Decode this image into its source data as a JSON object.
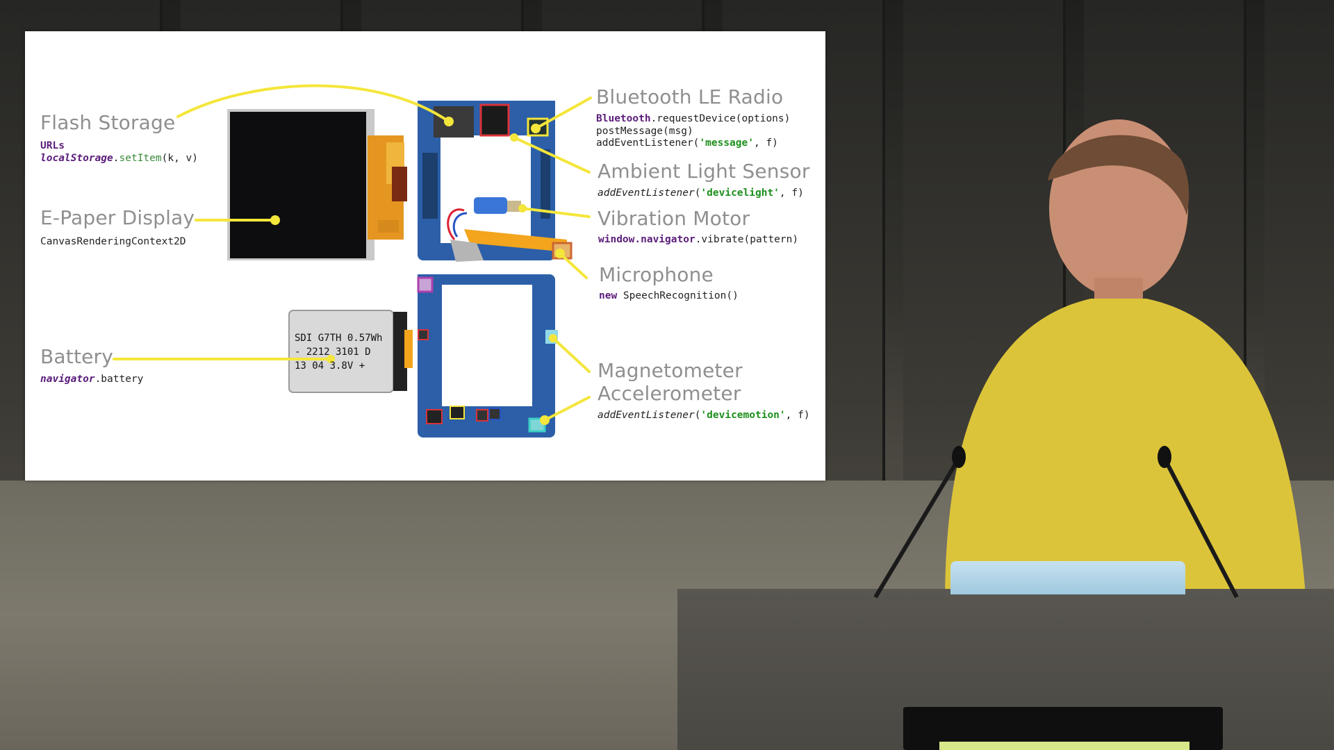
{
  "slide": {
    "flash": {
      "title": "Flash Storage",
      "code_line1": "URLs",
      "code_kw": "localStorage",
      "code_dot": ".",
      "code_fn": "setItem",
      "code_args": "(k, v)"
    },
    "epaper": {
      "title": "E-Paper Display",
      "code": "CanvasRenderingContext2D"
    },
    "battery": {
      "title": "Battery",
      "code_kw": "navigator",
      "code_rest": ".battery",
      "label_text": "SDI G7TH 0.57Wh - 2212 3101 D 13 04 3.8V +"
    },
    "bluetooth": {
      "title": "Bluetooth LE Radio",
      "code_kw": "Bluetooth",
      "code_rest1": ".requestDevice(options)",
      "code_line2": "postMessage(msg)",
      "code_line3_a": "addEventListener(",
      "code_line3_str": "'message'",
      "code_line3_b": ", f)"
    },
    "light": {
      "title": "Ambient Light Sensor",
      "code_a": "addEventListener",
      "code_b": "(",
      "code_str": "'devicelight'",
      "code_c": ", f)"
    },
    "vibration": {
      "title": "Vibration Motor",
      "code_kw": "window.navigator",
      "code_rest": ".vibrate(pattern)"
    },
    "microphone": {
      "title": "Microphone",
      "code_kw": "new",
      "code_rest": " SpeechRecognition()"
    },
    "magnetometer": {
      "title": "Magnetometer"
    },
    "accelerometer": {
      "title": "Accelerometer",
      "code_a": "addEventListener",
      "code_b": "(",
      "code_str": "'devicemotion'",
      "code_c": ", f)"
    }
  },
  "colors": {
    "accent_line": "#f4e63a",
    "code_keyword": "#5b1d7a",
    "code_string": "#1d8f1d",
    "label_gray": "#8f8f8f",
    "board_blue": "#2c5fa8",
    "flex_orange": "#e79a21",
    "shirt_yellow": "#dcc43a"
  }
}
